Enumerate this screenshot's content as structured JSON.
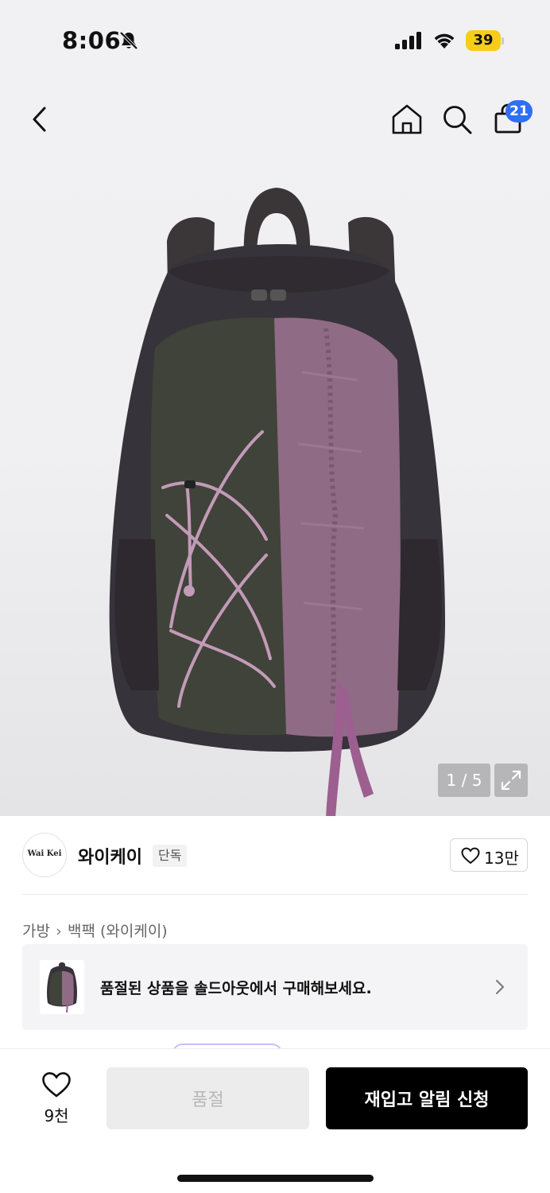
{
  "status_bar": {
    "time": "8:06",
    "battery_level": "39",
    "icons": [
      "bell-slash-icon",
      "signal-icon",
      "wifi-icon",
      "battery-icon"
    ]
  },
  "header": {
    "nav_icons": [
      "back-icon",
      "home-icon",
      "search-icon",
      "shopping-bag-icon"
    ],
    "cart_count": "21"
  },
  "gallery": {
    "counter_current": "1",
    "counter_separator": " / ",
    "counter_total": "5",
    "expand_icon": "expand-icon"
  },
  "brand": {
    "logo_text": "Wai Kei",
    "name": "와이케이",
    "exclusive_badge": "단독",
    "like_count": "13만"
  },
  "breadcrumb": {
    "items": [
      "가방",
      "백팩 (와이케이)"
    ],
    "separator_icon": "chevron-right-icon"
  },
  "soldout_banner": {
    "text": "품절된 상품을 솔드아웃에서 구매해보세요."
  },
  "bottom_bar": {
    "wish_count": "9천",
    "soldout_label": "품절",
    "restock_label": "재입고 알림 신청"
  },
  "colors": {
    "accent_badge": "#2e6ff5",
    "battery": "#f7cd19",
    "primary_button": "#000000",
    "disabled_button": "#ececec"
  }
}
